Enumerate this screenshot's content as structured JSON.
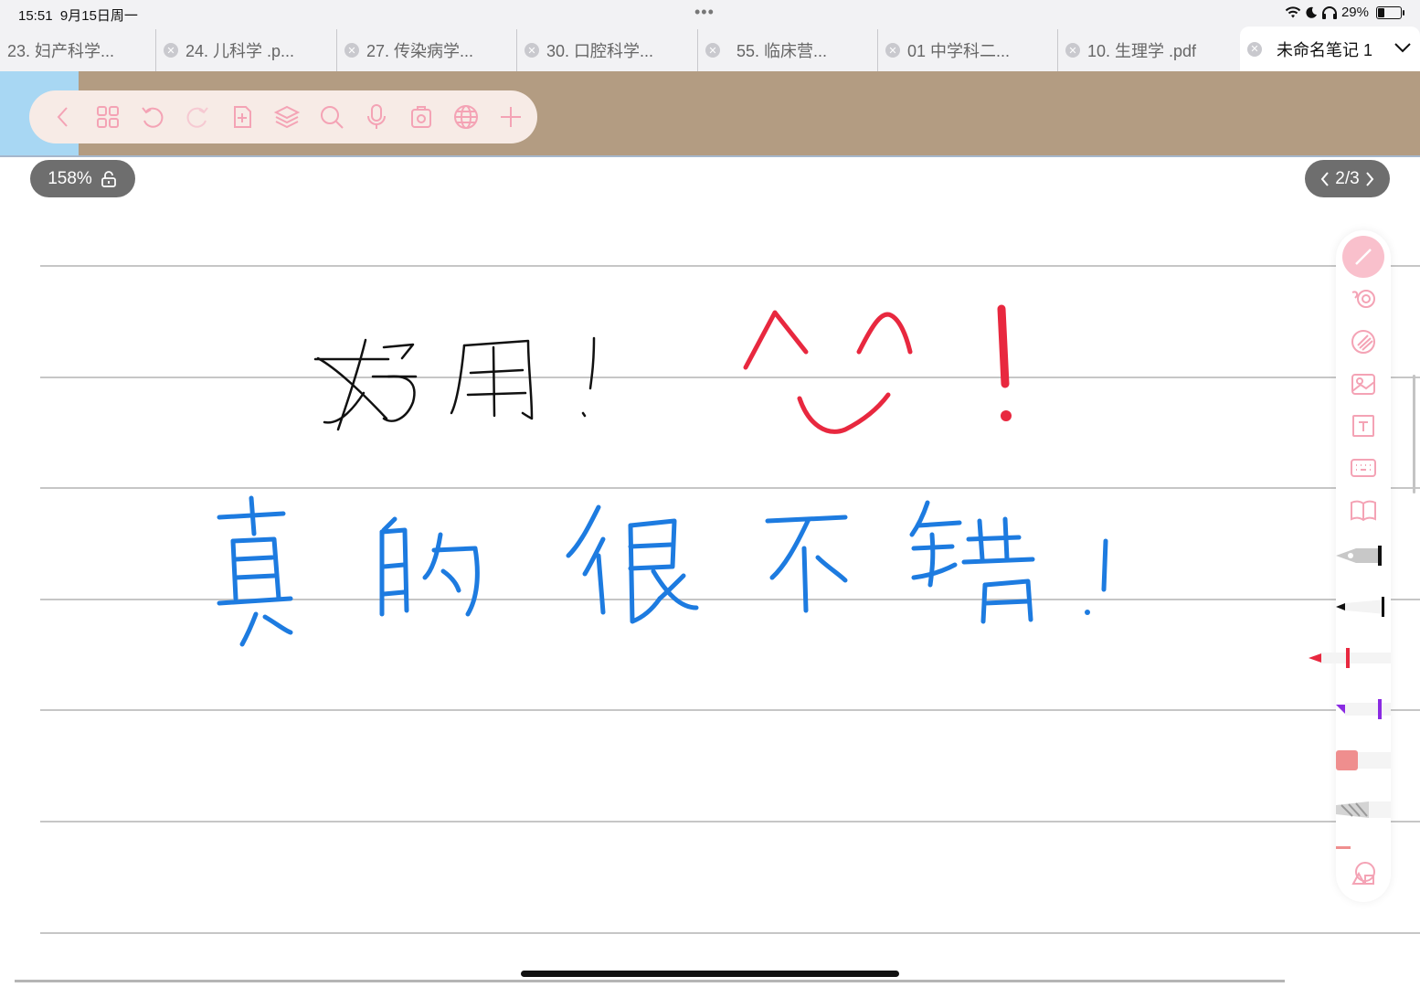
{
  "status_bar": {
    "time": "15:51",
    "date": "9月15日周一",
    "battery_percent": "29%",
    "battery_level": 0.29,
    "multitask_dots": "•••"
  },
  "tabs": [
    {
      "label": "23. 妇产科学..."
    },
    {
      "label": "24. 儿科学 .p..."
    },
    {
      "label": "27. 传染病学..."
    },
    {
      "label": "30. 口腔科学..."
    },
    {
      "label": "55. 临床营..."
    },
    {
      "label": "01 中学科二..."
    },
    {
      "label": "10. 生理学 .pdf"
    },
    {
      "label": "未命名笔记 1",
      "active": true
    }
  ],
  "toolbar": {
    "icons": [
      "back-icon",
      "grid-icon",
      "undo-icon",
      "redo-icon",
      "add-page-icon",
      "layers-icon",
      "search-icon",
      "microphone-icon",
      "clipboard-icon",
      "globe-icon",
      "add-icon"
    ],
    "accent_color": "#f4a3b5"
  },
  "zoom": {
    "label": "158%"
  },
  "page_indicator": {
    "label": "2/3",
    "current": 2,
    "total": 3
  },
  "canvas": {
    "background_color": "#b39c82",
    "handwriting": [
      {
        "text": "好用!",
        "color": "#111111"
      },
      {
        "text": "^_^!",
        "color": "#e8283f"
      },
      {
        "text": "真的很不错!",
        "color": "#1d7be0"
      }
    ]
  },
  "right_toolbar": {
    "items": [
      "pen-tool-icon",
      "lasso-icon",
      "eraser-icon",
      "image-icon",
      "text-box-icon",
      "keyboard-icon",
      "book-icon",
      "fountain-pen-icon",
      "ballpoint-pen-icon",
      "red-marker-icon",
      "purple-highlighter-icon",
      "pink-eraser-icon",
      "pencil-icon",
      "shapes-icon"
    ],
    "colors": {
      "active": "#f9c0cc",
      "red_marker": "#e8283f",
      "purple_highlighter": "#8a2be2",
      "pink_eraser": "#ef8e8e"
    }
  }
}
